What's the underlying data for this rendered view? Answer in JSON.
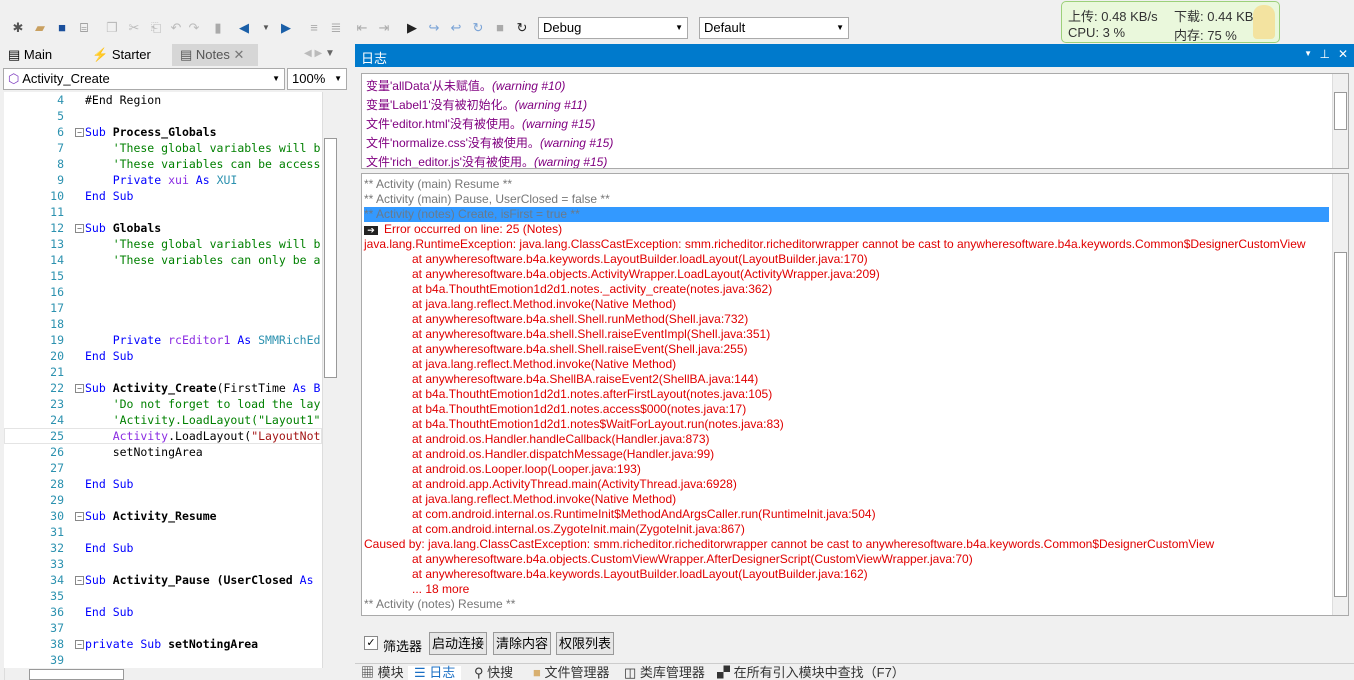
{
  "toolbar": {
    "config_combo": "Debug",
    "target_combo": "Default"
  },
  "netmon": {
    "upload": "上传: 0.48 KB/s",
    "download": "下载: 0.44 KB/s",
    "cpu": "CPU: 3 %",
    "memory": "内存: 75 %"
  },
  "editor_tabs": [
    {
      "label": "Main"
    },
    {
      "label": "Starter"
    },
    {
      "label": "Notes"
    }
  ],
  "editor": {
    "sub_combo": "Activity_Create",
    "zoom_combo": "100%",
    "lines": [
      {
        "n": "4",
        "parts": [
          [
            "",
            "#End Region"
          ]
        ]
      },
      {
        "n": "5",
        "parts": []
      },
      {
        "n": "6",
        "fold": true,
        "parts": [
          [
            "kw",
            "Sub "
          ],
          [
            "id",
            "Process_Globals"
          ]
        ]
      },
      {
        "n": "7",
        "parts": [
          [
            "cm",
            "    'These global variables will b"
          ]
        ]
      },
      {
        "n": "8",
        "parts": [
          [
            "cm",
            "    'These variables can be access"
          ]
        ]
      },
      {
        "n": "9",
        "parts": [
          [
            "kw",
            "    Private "
          ],
          [
            "vr",
            "xui "
          ],
          [
            "kw",
            "As "
          ],
          [
            "ty",
            "XUI"
          ]
        ]
      },
      {
        "n": "10",
        "parts": [
          [
            "kw",
            "End Sub"
          ]
        ]
      },
      {
        "n": "11",
        "parts": []
      },
      {
        "n": "12",
        "fold": true,
        "parts": [
          [
            "kw",
            "Sub "
          ],
          [
            "id",
            "Globals"
          ]
        ]
      },
      {
        "n": "13",
        "parts": [
          [
            "cm",
            "    'These global variables will b"
          ]
        ]
      },
      {
        "n": "14",
        "parts": [
          [
            "cm",
            "    'These variables can only be a"
          ]
        ]
      },
      {
        "n": "15",
        "parts": []
      },
      {
        "n": "16",
        "parts": []
      },
      {
        "n": "17",
        "parts": []
      },
      {
        "n": "18",
        "parts": []
      },
      {
        "n": "19",
        "parts": [
          [
            "kw",
            "    Private "
          ],
          [
            "vr",
            "rcEditor1 "
          ],
          [
            "kw",
            "As "
          ],
          [
            "ty",
            "SMMRichEd"
          ]
        ]
      },
      {
        "n": "20",
        "parts": [
          [
            "kw",
            "End Sub"
          ]
        ]
      },
      {
        "n": "21",
        "parts": []
      },
      {
        "n": "22",
        "fold": true,
        "parts": [
          [
            "kw",
            "Sub "
          ],
          [
            "id",
            "Activity_Create"
          ],
          [
            "",
            "(FirstTime "
          ],
          [
            "kw",
            "As B"
          ]
        ]
      },
      {
        "n": "23",
        "parts": [
          [
            "cm",
            "    'Do not forget to load the lay"
          ]
        ]
      },
      {
        "n": "24",
        "parts": [
          [
            "cm",
            "    'Activity.LoadLayout(\"Layout1\""
          ]
        ]
      },
      {
        "n": "25",
        "parts": [
          [
            "vr",
            "    Activity"
          ],
          [
            "",
            ".LoadLayout("
          ],
          [
            "st",
            "\"LayoutNot"
          ]
        ]
      },
      {
        "n": "26",
        "parts": [
          [
            "",
            "    setNotingArea"
          ]
        ]
      },
      {
        "n": "27",
        "parts": []
      },
      {
        "n": "28",
        "parts": [
          [
            "kw",
            "End Sub"
          ]
        ]
      },
      {
        "n": "29",
        "parts": []
      },
      {
        "n": "30",
        "fold": true,
        "parts": [
          [
            "kw",
            "Sub "
          ],
          [
            "id",
            "Activity_Resume"
          ]
        ]
      },
      {
        "n": "31",
        "parts": []
      },
      {
        "n": "32",
        "parts": [
          [
            "kw",
            "End Sub"
          ]
        ]
      },
      {
        "n": "33",
        "parts": []
      },
      {
        "n": "34",
        "fold": true,
        "parts": [
          [
            "kw",
            "Sub "
          ],
          [
            "id",
            "Activity_Pause"
          ],
          [
            "id",
            " (UserClosed "
          ],
          [
            "kw",
            "As"
          ]
        ]
      },
      {
        "n": "35",
        "parts": []
      },
      {
        "n": "36",
        "parts": [
          [
            "kw",
            "End Sub"
          ]
        ]
      },
      {
        "n": "37",
        "parts": []
      },
      {
        "n": "38",
        "fold": true,
        "parts": [
          [
            "kw",
            "private Sub "
          ],
          [
            "id",
            "setNotingArea"
          ]
        ]
      },
      {
        "n": "39",
        "parts": []
      }
    ]
  },
  "log_panel": {
    "title": "日志",
    "warnings": [
      {
        "text": "变量'allData'从未赋值。",
        "code": "(warning #10)"
      },
      {
        "text": "变量'Label1'没有被初始化。",
        "code": "(warning #11)"
      },
      {
        "text": "文件'editor.html'没有被使用。",
        "code": "(warning #15)"
      },
      {
        "text": "文件'normalize.css'没有被使用。",
        "code": "(warning #15)"
      },
      {
        "text": "文件'rich_editor.js'没有被使用。",
        "code": "(warning #15)"
      }
    ],
    "entries": [
      {
        "t": "info",
        "text": "** Activity (main) Resume **"
      },
      {
        "t": "info",
        "text": "** Activity (main) Pause, UserClosed = false **"
      },
      {
        "t": "sel",
        "text": "** Activity (notes) Create, isFirst = true **"
      },
      {
        "t": "errline",
        "text": "Error occurred on line: 25 (Notes)"
      },
      {
        "t": "err",
        "text": "java.lang.RuntimeException: java.lang.ClassCastException: smm.richeditor.richeditorwrapper cannot be cast to anywheresoftware.b4a.keywords.Common$DesignerCustomView"
      },
      {
        "t": "stack",
        "text": "at anywheresoftware.b4a.keywords.LayoutBuilder.loadLayout(LayoutBuilder.java:170)"
      },
      {
        "t": "stack",
        "text": "at anywheresoftware.b4a.objects.ActivityWrapper.LoadLayout(ActivityWrapper.java:209)"
      },
      {
        "t": "stack",
        "text": "at b4a.ThouthtEmotion1d2d1.notes._activity_create(notes.java:362)"
      },
      {
        "t": "stack",
        "text": "at java.lang.reflect.Method.invoke(Native Method)"
      },
      {
        "t": "stack",
        "text": "at anywheresoftware.b4a.shell.Shell.runMethod(Shell.java:732)"
      },
      {
        "t": "stack",
        "text": "at anywheresoftware.b4a.shell.Shell.raiseEventImpl(Shell.java:351)"
      },
      {
        "t": "stack",
        "text": "at anywheresoftware.b4a.shell.Shell.raiseEvent(Shell.java:255)"
      },
      {
        "t": "stack",
        "text": "at java.lang.reflect.Method.invoke(Native Method)"
      },
      {
        "t": "stack",
        "text": "at anywheresoftware.b4a.ShellBA.raiseEvent2(ShellBA.java:144)"
      },
      {
        "t": "stack",
        "text": "at b4a.ThouthtEmotion1d2d1.notes.afterFirstLayout(notes.java:105)"
      },
      {
        "t": "stack",
        "text": "at b4a.ThouthtEmotion1d2d1.notes.access$000(notes.java:17)"
      },
      {
        "t": "stack",
        "text": "at b4a.ThouthtEmotion1d2d1.notes$WaitForLayout.run(notes.java:83)"
      },
      {
        "t": "stack",
        "text": "at android.os.Handler.handleCallback(Handler.java:873)"
      },
      {
        "t": "stack",
        "text": "at android.os.Handler.dispatchMessage(Handler.java:99)"
      },
      {
        "t": "stack",
        "text": "at android.os.Looper.loop(Looper.java:193)"
      },
      {
        "t": "stack",
        "text": "at android.app.ActivityThread.main(ActivityThread.java:6928)"
      },
      {
        "t": "stack",
        "text": "at java.lang.reflect.Method.invoke(Native Method)"
      },
      {
        "t": "stack",
        "text": "at com.android.internal.os.RuntimeInit$MethodAndArgsCaller.run(RuntimeInit.java:504)"
      },
      {
        "t": "stack",
        "text": "at com.android.internal.os.ZygoteInit.main(ZygoteInit.java:867)"
      },
      {
        "t": "err",
        "text": "Caused by: java.lang.ClassCastException: smm.richeditor.richeditorwrapper cannot be cast to anywheresoftware.b4a.keywords.Common$DesignerCustomView"
      },
      {
        "t": "stack",
        "text": "at anywheresoftware.b4a.objects.CustomViewWrapper.AfterDesignerScript(CustomViewWrapper.java:70)"
      },
      {
        "t": "stack",
        "text": "at anywheresoftware.b4a.keywords.LayoutBuilder.loadLayout(LayoutBuilder.java:162)"
      },
      {
        "t": "stack",
        "text": "... 18 more"
      },
      {
        "t": "info",
        "text": "** Activity (notes) Resume **"
      }
    ],
    "filter_label": "筛选器",
    "connect_button": "启动连接",
    "clear_button": "清除内容",
    "permissions_button": "权限列表"
  },
  "bottom_tabs": [
    {
      "label": "模块"
    },
    {
      "label": "日志"
    },
    {
      "label": "快搜"
    },
    {
      "label": "文件管理器"
    },
    {
      "label": "类库管理器"
    },
    {
      "label": "在所有引入模块中查找（F7）"
    }
  ],
  "colors": {
    "accent": "#007acc",
    "error": "#e00000",
    "warning": "#800080",
    "selection": "#3399ff"
  }
}
